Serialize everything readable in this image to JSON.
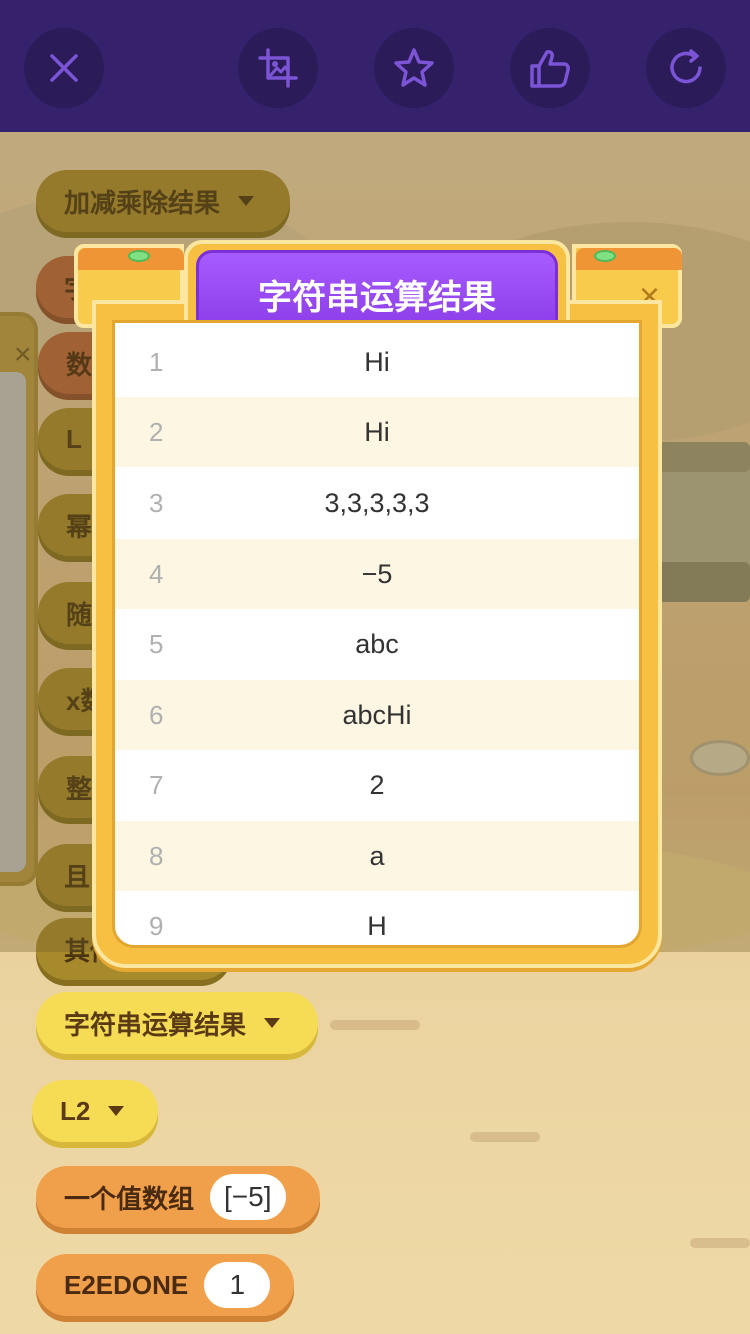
{
  "topbar": {
    "buttons": [
      {
        "icon": "close-icon"
      },
      {
        "icon": "screenshot-icon"
      },
      {
        "icon": "star-icon"
      },
      {
        "icon": "thumbs-up-icon"
      },
      {
        "icon": "refresh-icon"
      }
    ],
    "bg_color": "#36226c",
    "icon_color": "#7b55d6"
  },
  "palette": {
    "blocks_behind": [
      {
        "label": "加减乘除结果",
        "has_caret": true
      },
      {
        "label": "字"
      },
      {
        "label": "数"
      },
      {
        "label": "L"
      },
      {
        "label": "幂"
      },
      {
        "label": "随"
      },
      {
        "label": "x数"
      },
      {
        "label": "整"
      },
      {
        "label": "且"
      },
      {
        "label": "其他"
      }
    ],
    "string_result_block": "字符串运算结果",
    "l2_block": "L2",
    "array_block": {
      "label": "一个值数组",
      "value": "[−5]"
    },
    "done_block": {
      "label": "E2EDONE",
      "value": "1"
    }
  },
  "modal": {
    "title": "字符串运算结果",
    "close": "×",
    "rows": [
      {
        "index": "1",
        "value": "Hi"
      },
      {
        "index": "2",
        "value": "Hi"
      },
      {
        "index": "3",
        "value": "3,3,3,3,3"
      },
      {
        "index": "4",
        "value": "−5"
      },
      {
        "index": "5",
        "value": "abc"
      },
      {
        "index": "6",
        "value": "abcHi"
      },
      {
        "index": "7",
        "value": "2"
      },
      {
        "index": "8",
        "value": "a"
      },
      {
        "index": "9",
        "value": "H"
      }
    ],
    "title_color": "#9a4cf5",
    "frame_color": "#f7c042"
  }
}
